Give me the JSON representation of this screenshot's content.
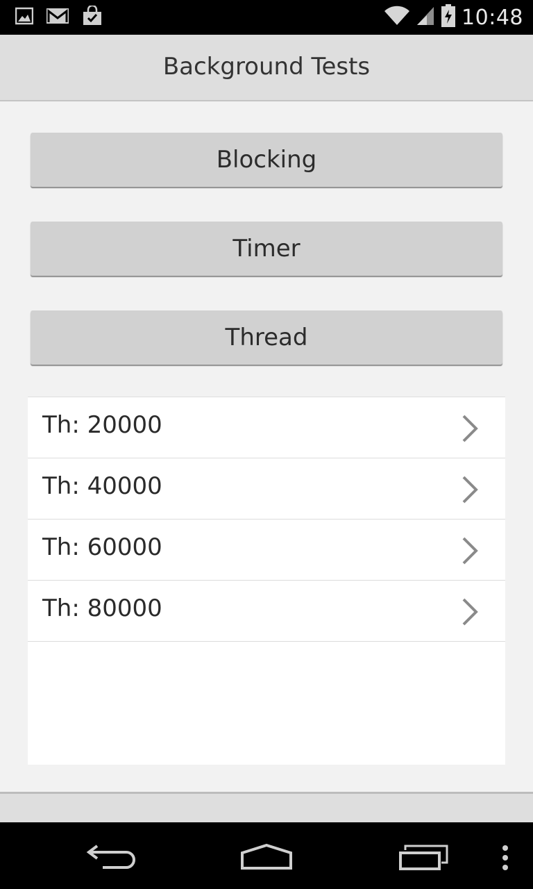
{
  "status_bar": {
    "time": "10:48",
    "left_icons": [
      "image-icon",
      "gmail-icon",
      "shopping-bag-icon"
    ],
    "right_icons": [
      "wifi-icon",
      "signal-icon",
      "battery-charging-icon"
    ]
  },
  "action_bar": {
    "title": "Background Tests"
  },
  "buttons": [
    {
      "label": "Blocking"
    },
    {
      "label": "Timer"
    },
    {
      "label": "Thread"
    }
  ],
  "list": {
    "items": [
      {
        "label": "Th: 20000"
      },
      {
        "label": "Th: 40000"
      },
      {
        "label": "Th: 60000"
      },
      {
        "label": "Th: 80000"
      }
    ]
  },
  "nav_bar": {
    "icons": [
      "back-icon",
      "home-icon",
      "recents-icon",
      "overflow-menu-icon"
    ]
  },
  "colors": {
    "action_bar_bg": "#dedede",
    "button_bg": "#d1d1d1",
    "content_bg": "#f2f2f2",
    "chevron": "#8a8a8a"
  }
}
